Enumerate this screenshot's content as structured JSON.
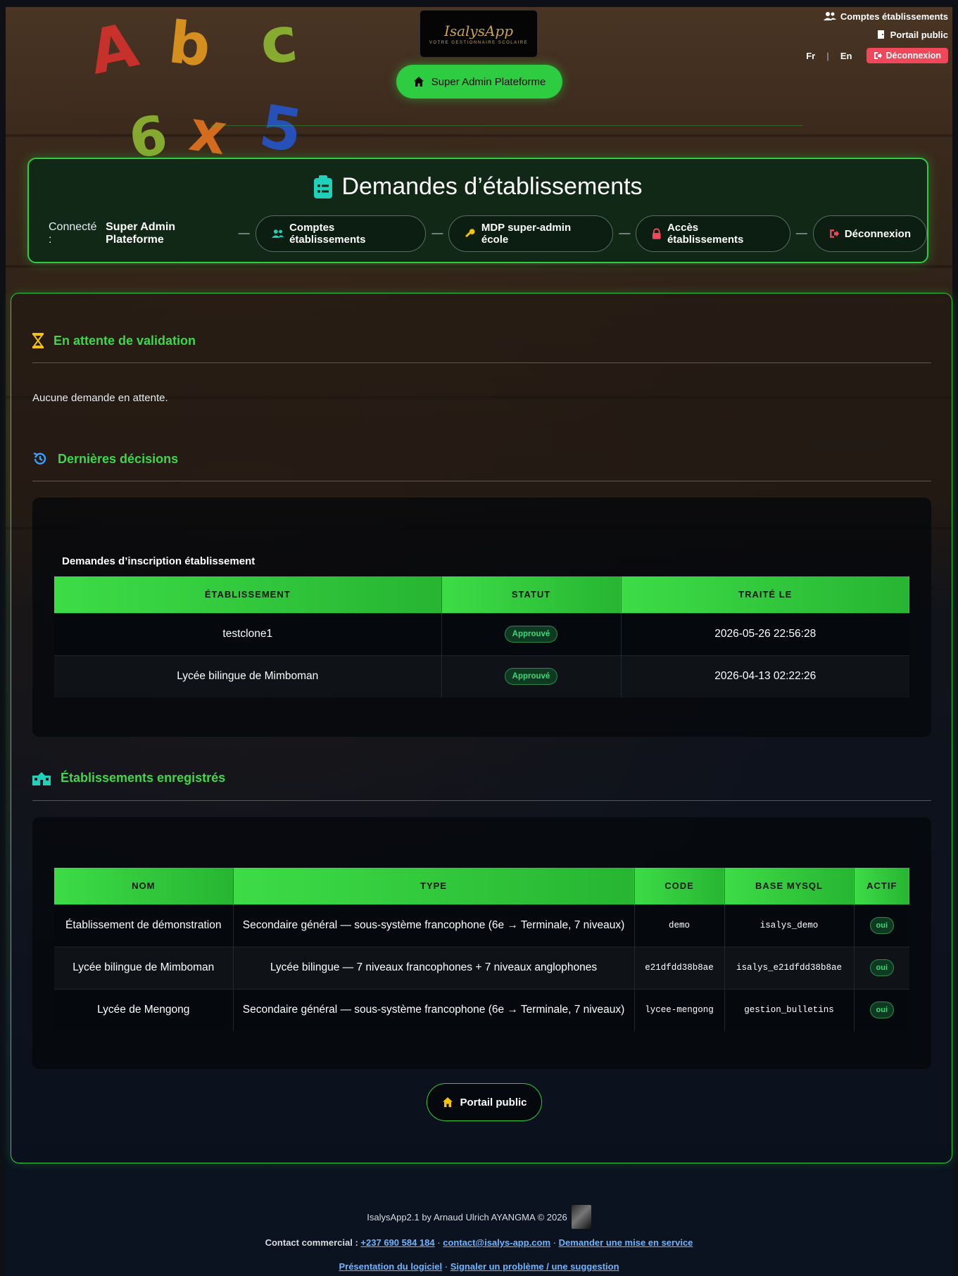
{
  "header": {
    "logo_text": "IsalysApp",
    "logo_tagline": "VOTRE GESTIONNAIRE SCOLAIRE",
    "home_pill": "Super Admin Plateforme",
    "top_links": {
      "accounts": "Comptes établissements",
      "portal": "Portail public"
    },
    "lang": {
      "fr": "Fr",
      "sep": "|",
      "en": "En"
    },
    "logout": "Déconnexion"
  },
  "page": {
    "title": "Demandes d’établissements",
    "connected_label": "Connecté :",
    "connected_user": "Super Admin Plateforme",
    "dash": "—",
    "nav": [
      {
        "label": "Comptes établissements",
        "icon": "users-icon"
      },
      {
        "label": "MDP super-admin école",
        "icon": "key-icon"
      },
      {
        "label": "Accès établissements",
        "icon": "lock-icon"
      },
      {
        "label": "Déconnexion",
        "icon": "sign-out-icon"
      }
    ]
  },
  "pending": {
    "title": "En attente de validation",
    "empty": "Aucune demande en attente."
  },
  "decisions": {
    "title": "Dernières décisions",
    "caption": "Demandes d’inscription établissement",
    "columns": [
      "ÉTABLISSEMENT",
      "STATUT",
      "TRAITÉ LE"
    ],
    "rows": [
      {
        "name": "testclone1",
        "status": "Approuvé",
        "date": "2026-05-26 22:56:28"
      },
      {
        "name": "Lycée bilingue de Mimboman",
        "status": "Approuvé",
        "date": "2026-04-13 02:22:26"
      }
    ]
  },
  "registered": {
    "title": "Établissements enregistrés",
    "columns": [
      "NOM",
      "TYPE",
      "CODE",
      "BASE MYSQL",
      "ACTIF"
    ],
    "rows": [
      {
        "name": "Établissement de démonstration",
        "type": "Secondaire général — sous-système francophone (6e → Terminale, 7 niveaux)",
        "code": "demo",
        "db": "isalys_demo",
        "active": "oui"
      },
      {
        "name": "Lycée bilingue de Mimboman",
        "type": "Lycée bilingue — 7 niveaux francophones + 7 niveaux anglophones",
        "code": "e21dfdd38b8ae",
        "db": "isalys_e21dfdd38b8ae",
        "active": "oui"
      },
      {
        "name": "Lycée de Mengong",
        "type": "Secondaire général — sous-système francophone (6e → Terminale, 7 niveaux)",
        "code": "lycee-mengong",
        "db": "gestion_bulletins",
        "active": "oui"
      }
    ]
  },
  "portal_button": "Portail public",
  "footer": {
    "credit": "IsalysApp2.1 by Arnaud Ulrich AYANGMA © 2026",
    "contact_label": "Contact commercial :",
    "phone": "+237 690 584 184",
    "email": "contact@isalys-app.com",
    "service_link": "Demander une mise en service",
    "presentation_link": "Présentation du logiciel",
    "report_link": "Signaler un problème / une suggestion",
    "sep": "·"
  },
  "colors": {
    "accent": "#2ecc40",
    "danger": "#f0475a",
    "link": "#6cb6ff"
  }
}
